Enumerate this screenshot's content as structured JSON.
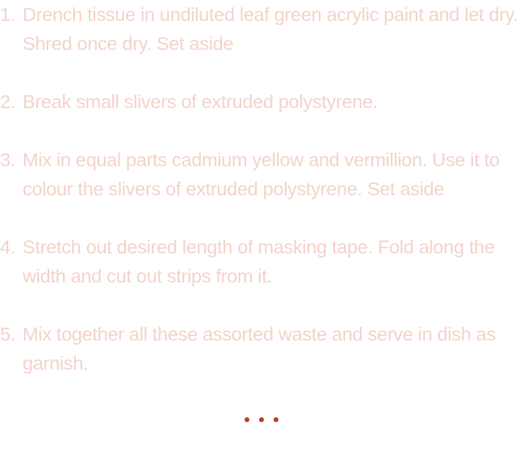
{
  "steps": [
    {
      "number": "1.",
      "text": "Drench tissue in undiluted leaf green acrylic paint and let dry. Shred once dry. Set aside"
    },
    {
      "number": "2.",
      "text": "Break small slivers of extruded polystyrene."
    },
    {
      "number": "3.",
      "text": "Mix in equal parts cadmium yellow and vermillion. Use it to colour the slivers of extruded polystyrene. Set aside"
    },
    {
      "number": "4.",
      "text": "Stretch out desired length of masking tape. Fold along the width and cut out strips from it."
    },
    {
      "number": "5.",
      "text": "Mix together all these assorted waste and serve in dish as garnish."
    }
  ],
  "colors": {
    "text": "#f3d3cb",
    "accent": "#b3402a"
  },
  "ellipsis_icon": "more-dots-icon"
}
